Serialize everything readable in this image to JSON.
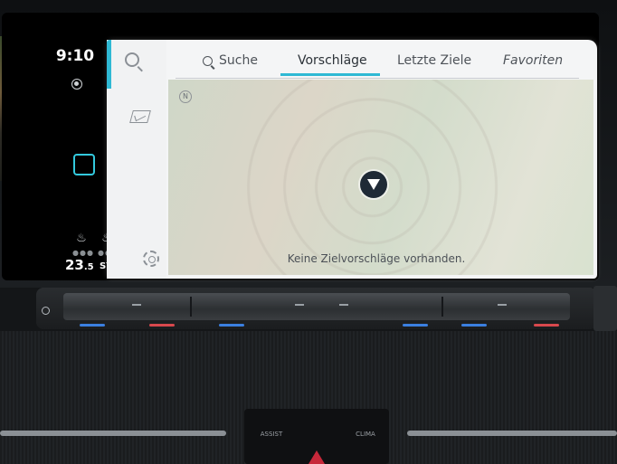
{
  "status": {
    "time": "9:10",
    "temperature_main": "23",
    "temperature_decimal": ".5",
    "sync_label": "SYNC"
  },
  "tabs": [
    {
      "label": "Suche"
    },
    {
      "label": "Vorschläge",
      "active": true
    },
    {
      "label": "Letzte Ziele"
    },
    {
      "label": "Favoriten"
    }
  ],
  "map": {
    "compass_label": "N",
    "message": "Keine Zielvorschläge vorhanden."
  },
  "dashboard": {
    "assist_label": "ASSIST",
    "clima_label": "CLIMA"
  },
  "colors": {
    "accent": "#2fb9d4",
    "panel": "#f4f5f6",
    "marker": "#1f2a36",
    "hazard": "#c7283a"
  },
  "icons": [
    "globe-icon",
    "home-icon",
    "seat-heat-icon",
    "steering-heat-icon",
    "search-icon",
    "map-mode-icon",
    "gear-icon",
    "compass-icon",
    "position-marker-icon",
    "power-icon",
    "hazard-icon"
  ]
}
